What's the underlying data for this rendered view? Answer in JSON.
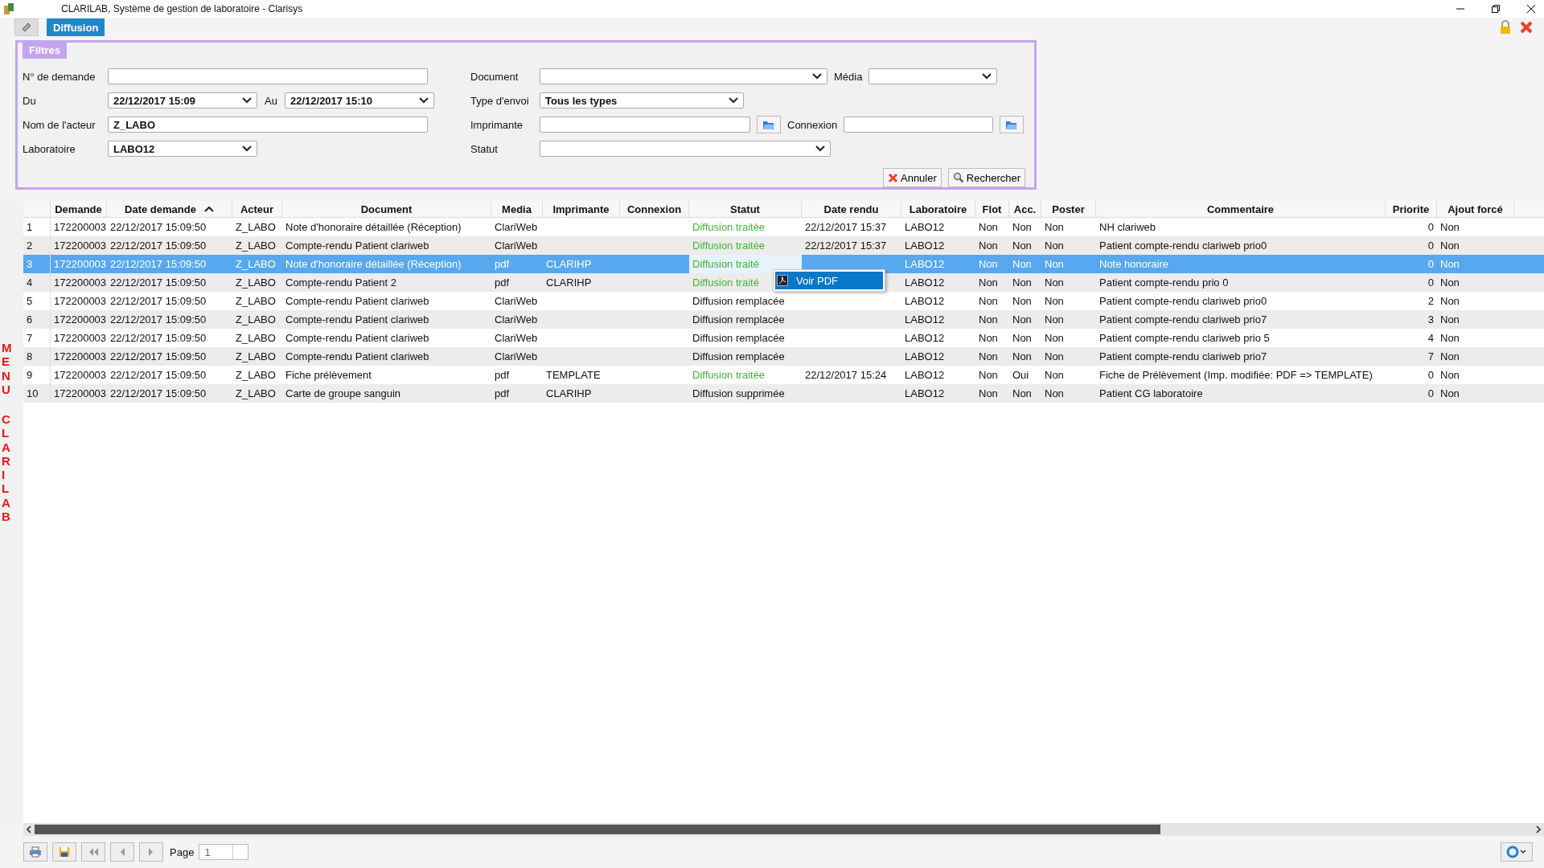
{
  "window": {
    "title": "CLARILAB, Système de gestion de laboratoire - Clarisys"
  },
  "tabs": [
    {
      "label": "Diffusion",
      "selected": true
    }
  ],
  "side_menu": {
    "labels": [
      "MENU",
      "CLARILAB"
    ]
  },
  "filters": {
    "title": "Filtres",
    "left": [
      {
        "kind": "text",
        "label": "N° de demande"
      },
      {
        "kind": "daterange",
        "label": "Du",
        "value": "22/12/2017 15:09",
        "label2": "Au",
        "value2": "22/12/2017 15:10"
      },
      {
        "kind": "text",
        "label": "Nom de l'acteur",
        "value": "Z_LABO"
      },
      {
        "kind": "select",
        "label": "Laboratoire",
        "value": "LABO12"
      }
    ],
    "right": [
      {
        "kind": "select",
        "label": "Document",
        "extra": {
          "kind": "select",
          "label": "Média"
        }
      },
      {
        "kind": "select",
        "label": "Type d'envoi",
        "value": "Tous les types"
      },
      {
        "kind": "picker",
        "label": "Imprimante",
        "extra": {
          "kind": "picker",
          "label": "Connexion"
        }
      },
      {
        "kind": "select",
        "label": "Statut"
      }
    ],
    "buttons": [
      {
        "kind": "cancel",
        "label": "Annuler"
      },
      {
        "kind": "search",
        "label": "Rechercher"
      }
    ]
  },
  "table": {
    "columns": [
      {
        "sorted": false
      },
      {
        "label": "Demande",
        "sorted": false
      },
      {
        "label": "Date demande",
        "sorted": true
      },
      {
        "label": "Acteur",
        "sorted": false
      },
      {
        "label": "Document",
        "sorted": false
      },
      {
        "label": "Media",
        "sorted": false
      },
      {
        "label": "Imprimante",
        "sorted": false
      },
      {
        "label": "Connexion",
        "sorted": false
      },
      {
        "label": "Statut",
        "sorted": false
      },
      {
        "label": "Date rendu",
        "sorted": false
      },
      {
        "label": "Laboratoire",
        "sorted": false
      },
      {
        "label": "Flot",
        "sorted": false
      },
      {
        "label": "Acc.",
        "sorted": false
      },
      {
        "label": "Poster",
        "sorted": false
      },
      {
        "label": "Commentaire",
        "sorted": false
      },
      {
        "label": "Priorite",
        "sorted": false
      },
      {
        "label": "Ajout forcé",
        "sorted": false
      }
    ],
    "rows": [
      {
        "selected": false,
        "treated": true,
        "cells": [
          "1",
          "172200003",
          "22/12/2017 15:09:50",
          "Z_LABO",
          "Note d'honoraire détaillée (Réception)",
          "ClariWeb",
          null,
          null,
          "Diffusion traitée",
          "22/12/2017 15:37",
          "LABO12",
          "Non",
          "Non",
          "Non",
          "NH clariweb",
          "0",
          "Non"
        ]
      },
      {
        "selected": false,
        "treated": true,
        "cells": [
          "2",
          "172200003",
          "22/12/2017 15:09:50",
          "Z_LABO",
          "Compte-rendu Patient clariweb",
          "ClariWeb",
          null,
          null,
          "Diffusion traitée",
          "22/12/2017 15:37",
          "LABO12",
          "Non",
          "Non",
          "Non",
          "Patient compte-rendu clariweb prio0",
          "0",
          "Non"
        ]
      },
      {
        "selected": true,
        "treated": true,
        "cells": [
          "3",
          "172200003",
          "22/12/2017 15:09:50",
          "Z_LABO",
          "Note d'honoraire détaillée (Réception)",
          "pdf",
          "CLARIHP",
          null,
          "Diffusion traité",
          null,
          "LABO12",
          "Non",
          "Non",
          "Non",
          "Note honoraire",
          "0",
          "Non"
        ]
      },
      {
        "selected": false,
        "treated": true,
        "cells": [
          "4",
          "172200003",
          "22/12/2017 15:09:50",
          "Z_LABO",
          "Compte-rendu Patient 2",
          "pdf",
          "CLARIHP",
          null,
          "Diffusion traité",
          null,
          "LABO12",
          "Non",
          "Non",
          "Non",
          "Patient compte-rendu prio 0",
          "0",
          "Non"
        ]
      },
      {
        "selected": false,
        "treated": false,
        "cells": [
          "5",
          "172200003",
          "22/12/2017 15:09:50",
          "Z_LABO",
          "Compte-rendu Patient clariweb",
          "ClariWeb",
          null,
          null,
          "Diffusion remplacée",
          null,
          "LABO12",
          "Non",
          "Non",
          "Non",
          "Patient compte-rendu clariweb prio0",
          "2",
          "Non"
        ]
      },
      {
        "selected": false,
        "treated": false,
        "cells": [
          "6",
          "172200003",
          "22/12/2017 15:09:50",
          "Z_LABO",
          "Compte-rendu Patient clariweb",
          "ClariWeb",
          null,
          null,
          "Diffusion remplacée",
          null,
          "LABO12",
          "Non",
          "Non",
          "Non",
          "Patient compte-rendu clariweb prio7",
          "3",
          "Non"
        ]
      },
      {
        "selected": false,
        "treated": false,
        "cells": [
          "7",
          "172200003",
          "22/12/2017 15:09:50",
          "Z_LABO",
          "Compte-rendu Patient clariweb",
          "ClariWeb",
          null,
          null,
          "Diffusion remplacée",
          null,
          "LABO12",
          "Non",
          "Non",
          "Non",
          "Patient compte-rendu clariweb prio 5",
          "4",
          "Non"
        ]
      },
      {
        "selected": false,
        "treated": false,
        "cells": [
          "8",
          "172200003",
          "22/12/2017 15:09:50",
          "Z_LABO",
          "Compte-rendu Patient clariweb",
          "ClariWeb",
          null,
          null,
          "Diffusion remplacée",
          null,
          "LABO12",
          "Non",
          "Non",
          "Non",
          "Patient compte-rendu clariweb prio7",
          "7",
          "Non"
        ]
      },
      {
        "selected": false,
        "treated": true,
        "cells": [
          "9",
          "172200003",
          "22/12/2017 15:09:50",
          "Z_LABO",
          "Fiche prélèvement",
          "pdf",
          "TEMPLATE",
          null,
          "Diffusion traitée",
          "22/12/2017 15:24",
          "LABO12",
          "Non",
          "Oui",
          "Non",
          "Fiche de Prélèvement (Imp. modifiée: PDF => TEMPLATE)",
          "0",
          "Non"
        ]
      },
      {
        "selected": false,
        "treated": false,
        "cells": [
          "10",
          "172200003",
          "22/12/2017 15:09:50",
          "Z_LABO",
          "Carte de groupe sanguin",
          "pdf",
          "CLARIHP",
          null,
          "Diffusion supprimée",
          null,
          "LABO12",
          "Non",
          "Non",
          "Non",
          "Patient CG laboratoire",
          "0",
          "Non"
        ]
      }
    ]
  },
  "context_menu": {
    "items": [
      {
        "label": "Voir PDF",
        "selected": true
      }
    ]
  },
  "pager": {
    "label": "Page",
    "value": "1"
  }
}
